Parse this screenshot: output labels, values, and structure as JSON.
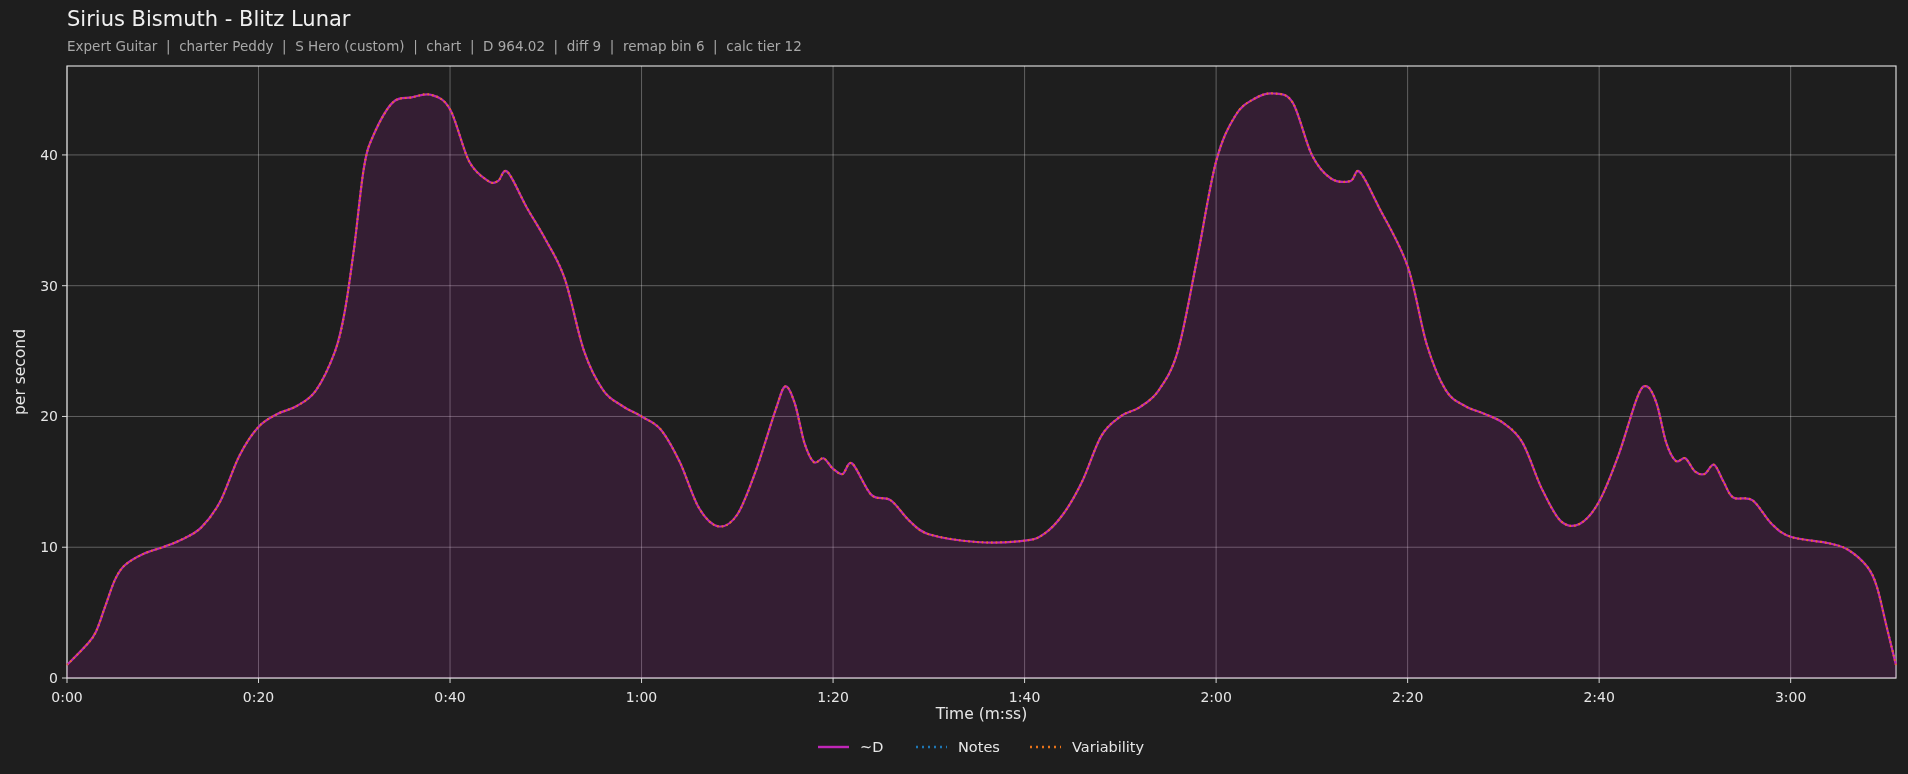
{
  "header": {
    "title": "Sirius Bismuth - Blitz Lunar",
    "subtitle": "Expert Guitar  |  charter Peddy  |  S Hero (custom)  |  chart  |  D 964.02  |  diff 9  |  remap bin 6  |  calc tier 12"
  },
  "chart_data": {
    "type": "line",
    "xlabel": "Time (m:ss)",
    "ylabel": "per second",
    "x": [
      0,
      2,
      3,
      4,
      5,
      6,
      8,
      10,
      12,
      14,
      16,
      18,
      20,
      22,
      24,
      26,
      28,
      29,
      30,
      31,
      32,
      34,
      36,
      38,
      40,
      42,
      44,
      45,
      46,
      48,
      50,
      52,
      54,
      56,
      58,
      60,
      62,
      64,
      66,
      68,
      70,
      72,
      74,
      75,
      76,
      77,
      78,
      79,
      80,
      81,
      82,
      84,
      86,
      88,
      90,
      95,
      100,
      102,
      104,
      106,
      108,
      110,
      112,
      114,
      116,
      118,
      120,
      122,
      124,
      126,
      128,
      130,
      132,
      134,
      135,
      137,
      140,
      142,
      144,
      146,
      148,
      150,
      152,
      154,
      156,
      158,
      160,
      162,
      164,
      165,
      166,
      167,
      168,
      169,
      170,
      171,
      172,
      173,
      174,
      176,
      178,
      180,
      184,
      186,
      188,
      189,
      190,
      191
    ],
    "series": [
      {
        "name": "~D",
        "type": "area",
        "color": "#c026b8",
        "values": [
          1,
          2.5,
          3.5,
          5.5,
          7.5,
          8.6,
          9.5,
          10,
          10.6,
          11.5,
          13.5,
          17,
          19.2,
          20.2,
          20.8,
          22,
          25,
          28,
          33,
          39,
          41.5,
          44,
          44.4,
          44.6,
          43.5,
          39.5,
          38,
          38,
          38.7,
          36,
          33.5,
          30.5,
          25,
          22,
          20.8,
          20,
          19,
          16.5,
          13,
          11.6,
          12.5,
          16,
          20.5,
          22.3,
          21,
          18,
          16.5,
          16.8,
          16,
          15.6,
          16.4,
          14,
          13.6,
          12,
          11,
          10.4,
          10.5,
          11,
          12.5,
          15,
          18.5,
          20,
          20.7,
          22,
          25,
          32,
          39.5,
          43,
          44.3,
          44.7,
          44,
          40,
          38.2,
          38,
          38.7,
          36,
          31.5,
          25.5,
          22,
          20.8,
          20.2,
          19.5,
          18,
          14.5,
          12,
          11.8,
          13.5,
          17,
          21.5,
          22.3,
          21,
          18,
          16.6,
          16.8,
          15.8,
          15.6,
          16.3,
          15,
          13.8,
          13.6,
          11.8,
          10.8,
          10.3,
          9.8,
          8.5,
          7,
          4,
          1
        ]
      },
      {
        "name": "Notes",
        "color": "#1f77b4",
        "line_style": "dotted",
        "values": [
          null,
          null,
          null,
          null,
          null,
          null,
          null,
          null,
          null,
          null,
          null,
          null,
          null,
          null,
          null,
          null,
          null,
          null,
          null,
          null,
          null,
          null,
          null,
          null,
          null,
          null,
          null,
          null,
          null,
          null,
          null,
          null,
          null,
          null,
          null,
          null,
          null,
          null,
          null,
          null,
          null,
          null,
          null,
          null,
          null,
          null,
          null,
          null,
          null,
          null,
          null,
          null,
          null,
          null,
          null,
          null,
          null,
          null,
          null,
          null,
          null,
          null,
          null,
          null,
          null,
          null,
          null,
          null,
          null,
          null,
          null,
          null,
          null,
          null,
          null,
          null,
          null,
          null,
          null,
          null,
          null,
          null,
          null,
          null,
          null,
          null,
          null,
          null,
          null,
          null,
          null,
          null,
          null,
          null,
          null,
          null,
          null,
          null,
          null,
          null,
          null,
          null,
          null,
          null,
          null,
          null,
          null,
          null
        ]
      },
      {
        "name": "Variability",
        "color": "#e8731a",
        "line_style": "dotted",
        "values": [
          1,
          2.5,
          3.5,
          5.5,
          7.5,
          8.6,
          9.5,
          10,
          10.6,
          11.5,
          13.5,
          17,
          19.2,
          20.2,
          20.8,
          22,
          25,
          28,
          33,
          39,
          41.5,
          44,
          44.4,
          44.6,
          43.5,
          39.5,
          38,
          38,
          38.7,
          36,
          33.5,
          30.5,
          25,
          22,
          20.8,
          20,
          19,
          16.5,
          13,
          11.6,
          12.5,
          16,
          20.5,
          22.3,
          21,
          18,
          16.5,
          16.8,
          16,
          15.6,
          16.4,
          14,
          13.6,
          12,
          11,
          10.4,
          10.5,
          11,
          12.5,
          15,
          18.5,
          20,
          20.7,
          22,
          25,
          32,
          39.5,
          43,
          44.3,
          44.7,
          44,
          40,
          38.2,
          38,
          38.7,
          36,
          31.5,
          25.5,
          22,
          20.8,
          20.2,
          19.5,
          18,
          14.5,
          12,
          11.8,
          13.5,
          17,
          21.5,
          22.3,
          21,
          18,
          16.6,
          16.8,
          15.8,
          15.6,
          16.3,
          15,
          13.8,
          13.6,
          11.8,
          10.8,
          10.3,
          9.8,
          8.5,
          7,
          4,
          1
        ]
      }
    ],
    "xlim": [
      0,
      191
    ],
    "grid": true,
    "legend": true,
    "ylim": [
      0,
      46.8
    ],
    "xticks": [
      {
        "value": 0,
        "label": "0:00"
      },
      {
        "value": 20,
        "label": "0:20"
      },
      {
        "value": 40,
        "label": "0:40"
      },
      {
        "value": 60,
        "label": "1:00"
      },
      {
        "value": 80,
        "label": "1:20"
      },
      {
        "value": 100,
        "label": "1:40"
      },
      {
        "value": 120,
        "label": "2:00"
      },
      {
        "value": 140,
        "label": "2:20"
      },
      {
        "value": 160,
        "label": "2:40"
      },
      {
        "value": 180,
        "label": "3:00"
      }
    ],
    "yticks": [
      0,
      10,
      20,
      30,
      40
    ]
  }
}
